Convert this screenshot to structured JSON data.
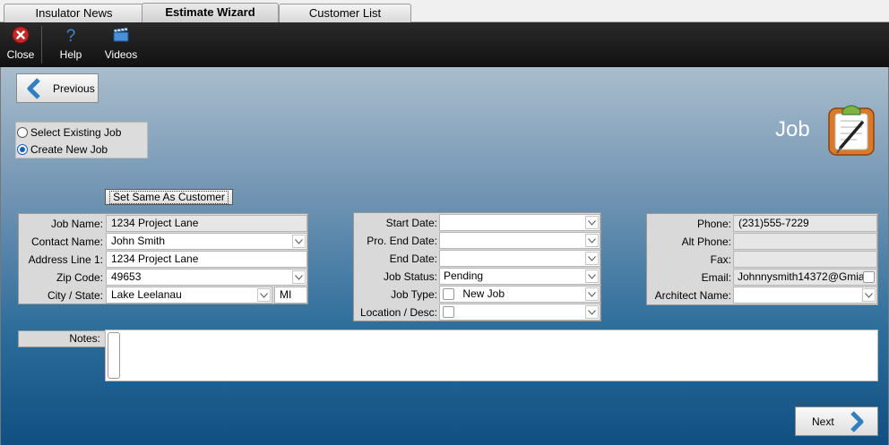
{
  "tabs": [
    {
      "label": "Insulator News",
      "active": false
    },
    {
      "label": "Estimate Wizard",
      "active": true
    },
    {
      "label": "Customer List",
      "active": false
    }
  ],
  "toolbar": {
    "close_label": "Close",
    "help_label": "Help",
    "videos_label": "Videos"
  },
  "nav": {
    "previous_label": "Previous",
    "next_label": "Next"
  },
  "job_mode": {
    "existing_label": "Select Existing Job",
    "new_label": "Create New Job",
    "selected": "new"
  },
  "heading": "Job",
  "set_same_label": "Set Same As Customer",
  "left": {
    "job_name_label": "Job Name:",
    "job_name": "1234 Project Lane",
    "contact_label": "Contact Name:",
    "contact": "John Smith",
    "address_label": "Address Line 1:",
    "address": "1234 Project Lane",
    "zip_label": "Zip Code:",
    "zip": "49653",
    "city_label": "City / State:",
    "city": "Lake Leelanau",
    "state": "MI"
  },
  "middle": {
    "start_label": "Start Date:",
    "start": "",
    "pro_end_label": "Pro. End Date:",
    "pro_end": "",
    "end_label": "End Date:",
    "end": "",
    "status_label": "Job Status:",
    "status": "Pending",
    "type_label": "Job Type:",
    "type": "New Job",
    "location_label": "Location / Desc:",
    "location": ""
  },
  "right": {
    "phone_label": "Phone:",
    "phone": "(231)555-7229",
    "alt_phone_label": "Alt Phone:",
    "alt_phone": "",
    "fax_label": "Fax:",
    "fax": "",
    "email_label": "Email:",
    "email": "Johnnysmith14372@Gmia",
    "architect_label": "Architect Name:",
    "architect": ""
  },
  "notes_label": "Notes:",
  "notes": "",
  "colors": {
    "accent": "#1a5fb4",
    "close_red": "#c62828",
    "arrow_blue": "#2f7fc1"
  }
}
